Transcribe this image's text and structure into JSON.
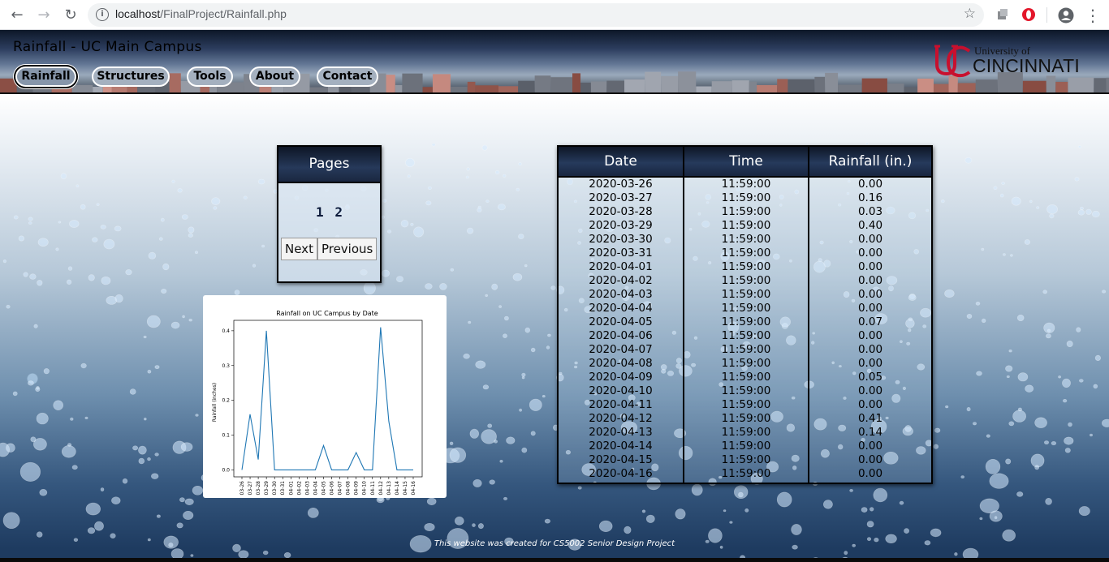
{
  "browser": {
    "url_host": "localhost",
    "url_path": "/FinalProject/Rainfall.php"
  },
  "header": {
    "title": "Rainfall - UC Main Campus",
    "logo_line1": "University of",
    "logo_line2": "CINCINNATI",
    "nav": [
      {
        "label": "Rainfall",
        "active": true
      },
      {
        "label": "Structures",
        "active": false
      },
      {
        "label": "Tools",
        "active": false
      },
      {
        "label": "About",
        "active": false
      },
      {
        "label": "Contact",
        "active": false
      }
    ]
  },
  "pagination": {
    "title": "Pages",
    "pages": [
      "1",
      "2"
    ],
    "next_label": "Next",
    "previous_label": "Previous"
  },
  "table": {
    "headers": [
      "Date",
      "Time",
      "Rainfall (in.)"
    ],
    "rows": [
      [
        "2020-03-26",
        "11:59:00",
        "0.00"
      ],
      [
        "2020-03-27",
        "11:59:00",
        "0.16"
      ],
      [
        "2020-03-28",
        "11:59:00",
        "0.03"
      ],
      [
        "2020-03-29",
        "11:59:00",
        "0.40"
      ],
      [
        "2020-03-30",
        "11:59:00",
        "0.00"
      ],
      [
        "2020-03-31",
        "11:59:00",
        "0.00"
      ],
      [
        "2020-04-01",
        "11:59:00",
        "0.00"
      ],
      [
        "2020-04-02",
        "11:59:00",
        "0.00"
      ],
      [
        "2020-04-03",
        "11:59:00",
        "0.00"
      ],
      [
        "2020-04-04",
        "11:59:00",
        "0.00"
      ],
      [
        "2020-04-05",
        "11:59:00",
        "0.07"
      ],
      [
        "2020-04-06",
        "11:59:00",
        "0.00"
      ],
      [
        "2020-04-07",
        "11:59:00",
        "0.00"
      ],
      [
        "2020-04-08",
        "11:59:00",
        "0.00"
      ],
      [
        "2020-04-09",
        "11:59:00",
        "0.05"
      ],
      [
        "2020-04-10",
        "11:59:00",
        "0.00"
      ],
      [
        "2020-04-11",
        "11:59:00",
        "0.00"
      ],
      [
        "2020-04-12",
        "11:59:00",
        "0.41"
      ],
      [
        "2020-04-13",
        "11:59:00",
        "0.14"
      ],
      [
        "2020-04-14",
        "11:59:00",
        "0.00"
      ],
      [
        "2020-04-15",
        "11:59:00",
        "0.00"
      ],
      [
        "2020-04-16",
        "11:59:00",
        "0.00"
      ]
    ]
  },
  "chart_data": {
    "type": "line",
    "title": "Rainfall on UC Campus by Date",
    "xlabel": "",
    "ylabel": "Rainfall (inches)",
    "x": [
      "03-26",
      "03-27",
      "03-28",
      "03-29",
      "03-30",
      "03-31",
      "04-01",
      "04-02",
      "04-03",
      "04-04",
      "04-05",
      "04-06",
      "04-07",
      "04-08",
      "04-09",
      "04-10",
      "04-11",
      "04-12",
      "04-13",
      "04-14",
      "04-15",
      "04-16"
    ],
    "series": [
      {
        "values": [
          0.0,
          0.16,
          0.03,
          0.4,
          0.0,
          0.0,
          0.0,
          0.0,
          0.0,
          0.0,
          0.07,
          0.0,
          0.0,
          0.0,
          0.05,
          0.0,
          0.0,
          0.41,
          0.14,
          0.0,
          0.0,
          0.0
        ],
        "color": "#1f77b4"
      }
    ],
    "yticks": [
      "0.0",
      "0.1",
      "0.2",
      "0.3",
      "0.4"
    ],
    "ylim": [
      -0.02,
      0.43
    ],
    "grid": false,
    "legend": "none"
  },
  "footer": {
    "text": "This website was created for CS5002 Senior Design Project"
  }
}
